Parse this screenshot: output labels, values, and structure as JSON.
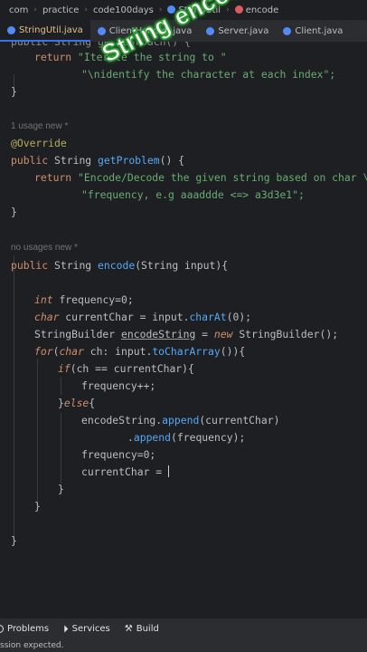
{
  "breadcrumb": {
    "items": [
      "com",
      "practice",
      "code100days",
      "StringUtil",
      "encode"
    ],
    "icons": [
      "class-icon",
      "method-icon"
    ]
  },
  "tabs": [
    {
      "label": "StringUtil.java",
      "active": true
    },
    {
      "label": "ClientHandler.java",
      "active": false
    },
    {
      "label": "Server.java",
      "active": false
    },
    {
      "label": "Client.java",
      "active": false
    }
  ],
  "overlay": {
    "caption": "String encoding"
  },
  "code": {
    "l0_prefix": "public String getApproach() {",
    "l1_return": "return",
    "l1_str": "\"Iterate the string to \"",
    "l2_str": "\"\\nidentify the character at each index\";",
    "l3_brace": "}",
    "hint1": "1 usage   new *",
    "annotation": "@Override",
    "l5_public": "public",
    "l5_type": "String",
    "l5_name": "getProblem",
    "l5_rest": "() {",
    "l6_return": "return",
    "l6_str": "\"Encode/Decode the given string based on char \\n\" +",
    "l7_str": "\"frequency, e.g aaaddde <=> a3d3e1\";",
    "l8_brace": "}",
    "hint2": "no usages   new *",
    "l9_public": "public",
    "l9_type": "String",
    "l9_name": "encode",
    "l9_rest": "(String input){",
    "l10_kw": "int",
    "l10_rest": "frequency=0;",
    "l11_kw": "char",
    "l11_var": "currentChar = input.",
    "l11_fn": "charAt",
    "l11_rest": "(0);",
    "l12_type": "StringBuilder",
    "l12_var": "encodeString",
    "l12_eq": " = ",
    "l12_new": "new",
    "l12_rest": " StringBuilder();",
    "l13_for": "for",
    "l13_open": "(",
    "l13_char": "char",
    "l13_mid": " ch: input.",
    "l13_fn": "toCharArray",
    "l13_rest": "()){",
    "l14_if": "if",
    "l14_rest": "(ch == currentChar){",
    "l15": "frequency++;",
    "l16_brace": "}",
    "l16_else": "else",
    "l16_open": "{",
    "l17_var": "encodeString.",
    "l17_fn": "append",
    "l17_rest": "(currentChar)",
    "l18_dot": ".",
    "l18_fn": "append",
    "l18_rest": "(frequency);",
    "l19": "frequency=0;",
    "l20": "currentChar = ",
    "l21_brace": "}",
    "l22_brace": "}",
    "l23_brace": "}"
  },
  "toolbar": {
    "problems_label": "Problems",
    "services_label": "Services",
    "build_label": "Build"
  },
  "status": {
    "message": "ssion expected."
  },
  "colors": {
    "keyword": "#cf8e6d",
    "string": "#6aab73",
    "function": "#56a8f5",
    "annotation": "#b3ae60",
    "overlay_glow": "#39c03f"
  }
}
